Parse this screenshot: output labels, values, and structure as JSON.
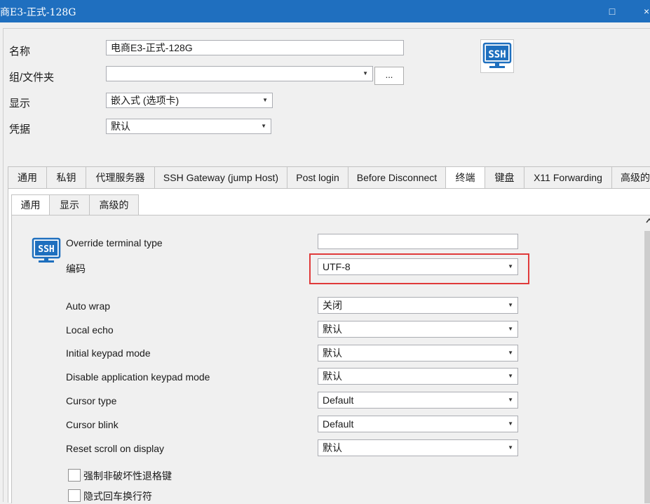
{
  "window": {
    "title": "商E3-正式-128G",
    "maximize_glyph": "□",
    "close_glyph": "×"
  },
  "form": {
    "name_label": "名称",
    "name_value": "电商E3-正式-128G",
    "group_label": "组/文件夹",
    "group_value": "",
    "browse_label": "...",
    "display_label": "显示",
    "display_value": "嵌入式 (选项卡)",
    "credentials_label": "凭据",
    "credentials_value": "默认"
  },
  "icons": {
    "ssh_badge_text": "SSH"
  },
  "tabs": [
    {
      "label": "通用"
    },
    {
      "label": "私钥"
    },
    {
      "label": "代理服务器"
    },
    {
      "label": "SSH Gateway (jump Host)"
    },
    {
      "label": "Post login"
    },
    {
      "label": "Before Disconnect"
    },
    {
      "label": "终端"
    },
    {
      "label": "键盘"
    },
    {
      "label": "X11 Forwarding"
    },
    {
      "label": "高级的"
    }
  ],
  "subtabs": [
    {
      "label": "通用"
    },
    {
      "label": "显示"
    },
    {
      "label": "高级的"
    }
  ],
  "terminal": {
    "override_type_label": "Override terminal type",
    "override_type_value": "",
    "encoding_label": "编码",
    "encoding_value": "UTF-8",
    "auto_wrap_label": "Auto wrap",
    "auto_wrap_value": "关闭",
    "local_echo_label": "Local echo",
    "local_echo_value": "默认",
    "initial_keypad_label": "Initial keypad mode",
    "initial_keypad_value": "默认",
    "disable_app_keypad_label": "Disable application keypad mode",
    "disable_app_keypad_value": "默认",
    "cursor_type_label": "Cursor type",
    "cursor_type_value": "Default",
    "cursor_blink_label": "Cursor blink",
    "cursor_blink_value": "Default",
    "reset_scroll_label": "Reset scroll on display",
    "reset_scroll_value": "默认",
    "force_nondestructive_backspace_label": "强制非破坏性退格键",
    "implicit_crlf_label": "隐式回车换行符"
  },
  "colors": {
    "titlebar": "#1f6fbf",
    "highlight": "#e03a3a",
    "ssh_blue": "#1e6fbe"
  }
}
